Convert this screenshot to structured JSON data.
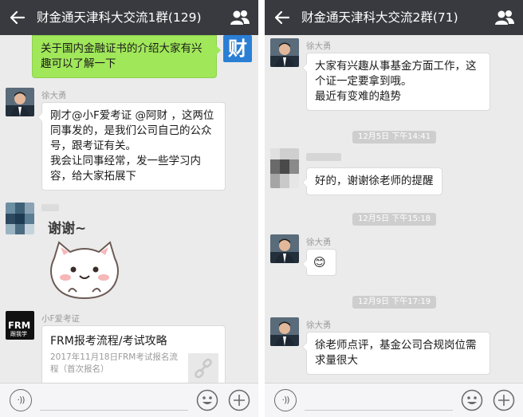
{
  "left": {
    "title": "财金通天津科大交流1群(129)",
    "messages": {
      "self_msg": {
        "lines": [
          "关于国内金融证书的介绍大家有兴",
          "趣可以了解一下"
        ],
        "avatar_char": "财"
      },
      "xu_msg": {
        "sender": "徐大勇",
        "lines": [
          "刚才@小F爱考证 @阿财 ，这两位",
          "同事发的，是我们公司自己的公众",
          "号，跟考证有关。",
          "我会让同事经常，发一些学习内",
          "容，给大家拓展下"
        ]
      },
      "sticker_msg": {
        "sticker_text": "谢谢~"
      },
      "card_msg": {
        "sender": "小F爱考证",
        "avatar_text": "FRM",
        "avatar_sub": "跟我学",
        "card_title": "FRM报考流程/考试攻略",
        "card_desc": "2017年11月18日FRM考试报名流程（首次报名）"
      }
    }
  },
  "right": {
    "title": "财金通天津科大交流2群(71)",
    "messages": {
      "xu_msg1": {
        "sender": "徐大勇",
        "lines": [
          "大家有兴趣从事基金方面工作，这",
          "个证一定要拿到哦。",
          "最近有变难的趋势"
        ]
      },
      "ts1": "12月5日 下午14:41",
      "thanks_msg": {
        "lines": [
          "好的，谢谢徐老师的提醒"
        ]
      },
      "ts2": "12月5日 下午15:18",
      "xu_msg2": {
        "sender": "徐大勇",
        "emoji": "😊"
      },
      "ts3": "12月9日 下午17:19",
      "xu_msg3": {
        "sender": "徐大勇",
        "lines": [
          "徐老师点评，基金公司合规岗位需",
          "求量很大"
        ]
      }
    }
  },
  "colors": {
    "topbar": "#393a3f",
    "chat_bg": "#ebebeb",
    "self_bubble": "#a0e75a",
    "other_bubble": "#ffffff"
  },
  "icons": [
    "back-arrow-icon",
    "group-members-icon",
    "voice-icon",
    "emoji-icon",
    "plus-icon",
    "link-icon"
  ]
}
